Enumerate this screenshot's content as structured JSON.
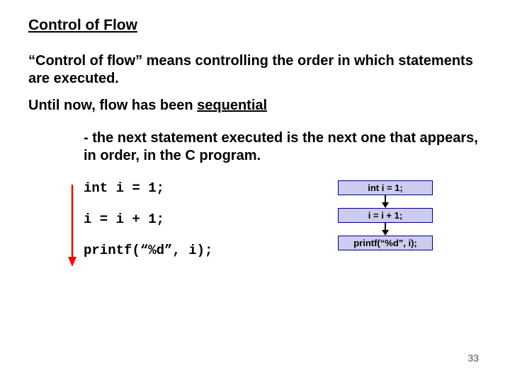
{
  "title": "Control of Flow",
  "para1": "“Control of flow” means controlling the order in which statements are executed.",
  "seq_prefix": "Until now, flow has been ",
  "seq_word": "sequential",
  "sub": "- the next statement executed is the next one that appears, in order, in the C program.",
  "code": {
    "l1": "int i = 1;",
    "l2": "i = i + 1;",
    "l3": "printf(“%d”, i);"
  },
  "diagram": {
    "b1": "int i = 1;",
    "b2": "i = i + 1;",
    "b3": "printf(“%d”, i);"
  },
  "pagenum": "33"
}
